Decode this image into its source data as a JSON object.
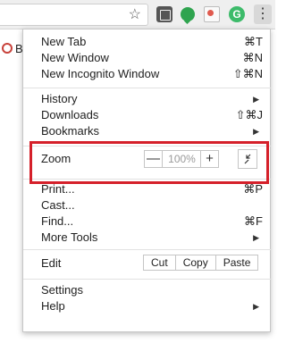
{
  "toolbar": {
    "bookmark_star": "☆",
    "extensions": [
      "puzzle-extension-icon",
      "evernote-icon",
      "image-extension-icon",
      "grammarly-icon"
    ],
    "grammarly_letter": "G",
    "menu_glyph": "⋮"
  },
  "bookmarks_bar": {
    "first_item": "B"
  },
  "menu": {
    "new_tab": {
      "label": "New Tab",
      "shortcut": "⌘T"
    },
    "new_window": {
      "label": "New Window",
      "shortcut": "⌘N"
    },
    "new_incognito": {
      "label": "New Incognito Window",
      "shortcut": "⇧⌘N"
    },
    "history": {
      "label": "History",
      "arrow": "▶"
    },
    "downloads": {
      "label": "Downloads",
      "shortcut": "⇧⌘J"
    },
    "bookmarks": {
      "label": "Bookmarks",
      "arrow": "▶"
    },
    "zoom": {
      "label": "Zoom",
      "minus": "—",
      "value": "100%",
      "plus": "+"
    },
    "print": {
      "label": "Print...",
      "shortcut": "⌘P"
    },
    "cast": {
      "label": "Cast..."
    },
    "find": {
      "label": "Find...",
      "shortcut": "⌘F"
    },
    "more_tools": {
      "label": "More Tools",
      "arrow": "▶"
    },
    "edit": {
      "label": "Edit",
      "cut": "Cut",
      "copy": "Copy",
      "paste": "Paste"
    },
    "settings": {
      "label": "Settings"
    },
    "help": {
      "label": "Help",
      "arrow": "▶"
    }
  },
  "colors": {
    "highlight": "#d5202a",
    "menu_bg": "#ffffff",
    "toolbar_bg": "#efefef"
  }
}
